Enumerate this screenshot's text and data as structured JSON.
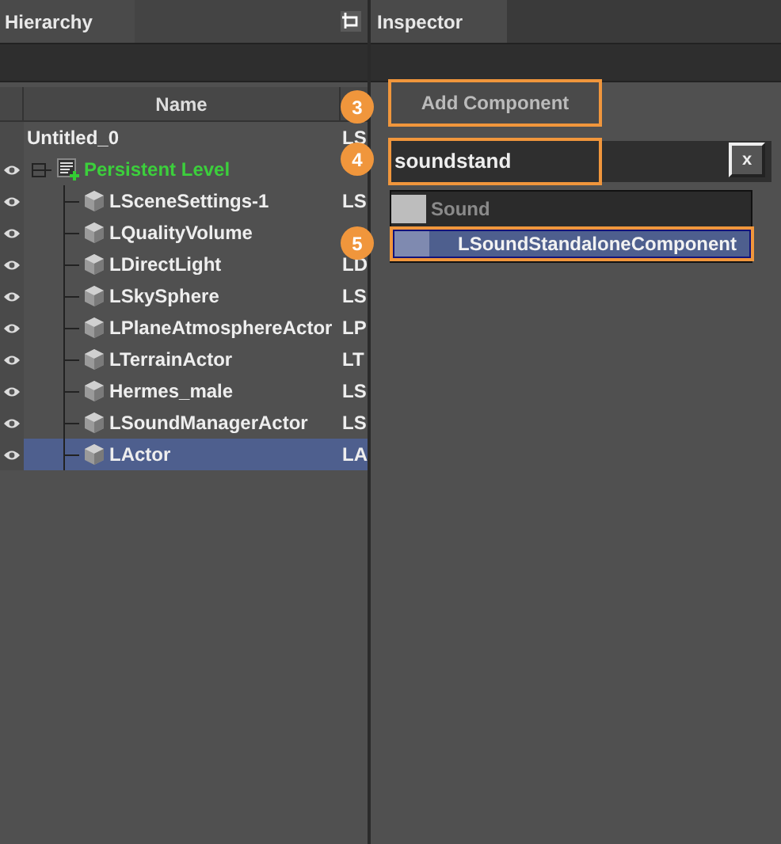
{
  "hierarchy": {
    "title": "Hierarchy",
    "columns": [
      "Name"
    ],
    "rows": [
      {
        "name": "Untitled_0",
        "column_2": "LS",
        "eye": false,
        "selected": false,
        "children": [
          {
            "name": "Persistent Level",
            "kind": "level",
            "eye": true,
            "selected": false,
            "children": [
              {
                "name": "LSceneSettings-1",
                "column_2": "LS",
                "kind": "actor",
                "eye": true,
                "selected": false
              },
              {
                "name": "LQualityVolume",
                "kind": "actor",
                "eye": true,
                "selected": false
              },
              {
                "name": "LDirectLight",
                "column_2": "LD",
                "kind": "actor",
                "eye": true,
                "selected": false
              },
              {
                "name": "LSkySphere",
                "column_2": "LS",
                "kind": "actor",
                "eye": true,
                "selected": false
              },
              {
                "name": "LPlaneAtmosphereActor",
                "column_2": "LP",
                "kind": "actor",
                "eye": true,
                "selected": false
              },
              {
                "name": "LTerrainActor",
                "column_2": "LT",
                "kind": "actor",
                "eye": true,
                "selected": false
              },
              {
                "name": "Hermes_male",
                "column_2": "LS",
                "kind": "actor",
                "eye": true,
                "selected": false
              },
              {
                "name": "LSoundManagerActor",
                "column_2": "LS",
                "kind": "actor",
                "eye": true,
                "selected": false
              },
              {
                "name": "LActor",
                "column_2": "LA",
                "kind": "actor",
                "eye": true,
                "selected": true
              }
            ]
          }
        ]
      }
    ]
  },
  "inspector": {
    "title": "Inspector",
    "add_component_button": "Add Component",
    "search": {
      "value": "soundstand",
      "clear_button": "x"
    },
    "results": [
      {
        "label": "Sound",
        "selected": false
      },
      {
        "label": "LSoundStandaloneComponent",
        "selected": true
      }
    ]
  },
  "callouts": [
    {
      "number": "3"
    },
    {
      "number": "4"
    },
    {
      "number": "5"
    }
  ]
}
